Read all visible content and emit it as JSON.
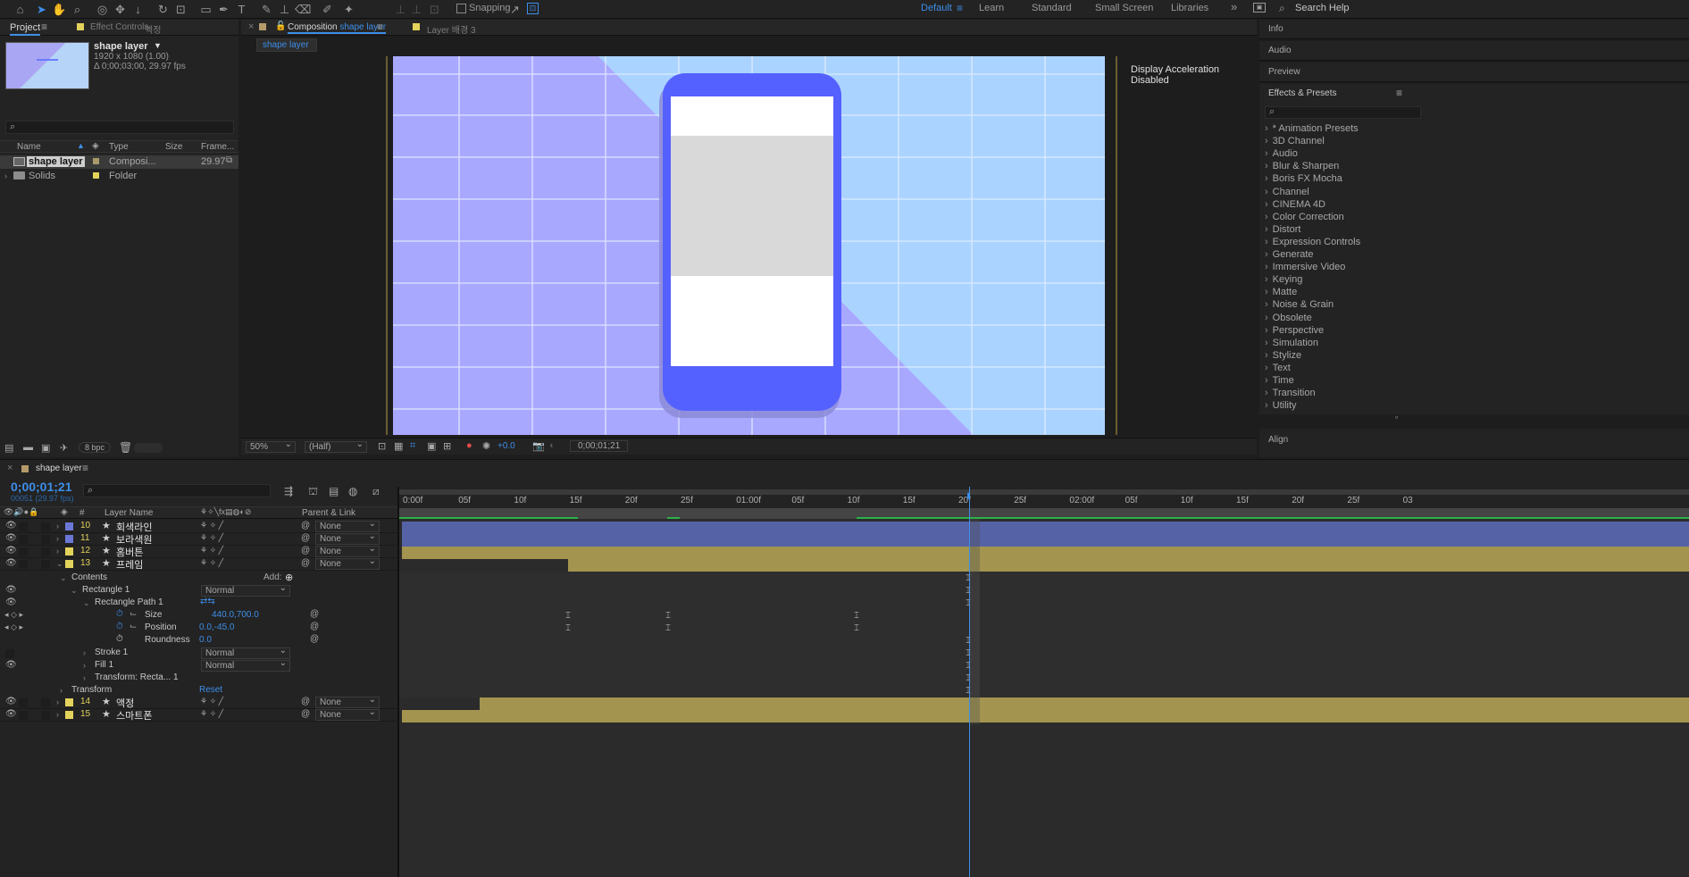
{
  "toolbar": {
    "snapping_label": "Snapping",
    "workspaces": [
      "Default",
      "Learn",
      "Standard",
      "Small Screen",
      "Libraries"
    ],
    "more": "»",
    "search_placeholder": "Search Help"
  },
  "project": {
    "tab_project": "Project",
    "tab_effect_controls": "Effect Controls",
    "tab_effect_controls_target": "액정",
    "comp_name": "shape layer",
    "comp_size": "1920 x 1080 (1.00)",
    "comp_duration": "Δ 0;00;03;00, 29.97 fps",
    "columns": [
      "Name",
      "Type",
      "Size",
      "Frame..."
    ],
    "items": [
      {
        "name": "shape layer",
        "type": "Composi...",
        "size": "",
        "fps": "29.97"
      },
      {
        "name": "Solids",
        "type": "Folder",
        "size": "",
        "fps": ""
      }
    ],
    "bpc": "8 bpc"
  },
  "composition": {
    "tab_label": "Composition",
    "tab_comp_name": "shape layer",
    "layer_tab": "Layer",
    "layer_tab_name": "배경 3",
    "breadcrumb": "shape layer",
    "accel_notice": "Display Acceleration Disabled",
    "zoom": "50%",
    "resolution": "(Half)",
    "exposure": "+0.0",
    "timecode": "0;00;01;21"
  },
  "right_panel": {
    "info": "Info",
    "audio": "Audio",
    "preview": "Preview",
    "effects_presets": "Effects & Presets",
    "effects": [
      "* Animation Presets",
      "3D Channel",
      "Audio",
      "Blur & Sharpen",
      "Boris FX Mocha",
      "Channel",
      "CINEMA 4D",
      "Color Correction",
      "Distort",
      "Expression Controls",
      "Generate",
      "Immersive Video",
      "Keying",
      "Matte",
      "Noise & Grain",
      "Obsolete",
      "Perspective",
      "Simulation",
      "Stylize",
      "Text",
      "Time",
      "Transition",
      "Utility"
    ],
    "align": "Align"
  },
  "timeline": {
    "tab_name": "shape layer",
    "timecode": "0;00;01;21",
    "frame_info": "00051 (29.97 fps)",
    "col_layer_name": "Layer Name",
    "col_num": "#",
    "col_parent": "Parent & Link",
    "ruler": [
      "0:00f",
      "05f",
      "10f",
      "15f",
      "20f",
      "25f",
      "01:00f",
      "05f",
      "10f",
      "15f",
      "20f",
      "25f",
      "02:00f",
      "05f",
      "10f",
      "15f",
      "20f",
      "25f",
      "03"
    ],
    "layers": [
      {
        "num": "10",
        "name": "회색라인",
        "parent": "None",
        "color": "#6b78d8"
      },
      {
        "num": "11",
        "name": "보라색원",
        "parent": "None",
        "color": "#6b78d8"
      },
      {
        "num": "12",
        "name": "홈버튼",
        "parent": "None",
        "color": "#e3d35b"
      },
      {
        "num": "13",
        "name": "프레임",
        "parent": "None",
        "color": "#e3d35b"
      }
    ],
    "props": {
      "contents": "Contents",
      "add": "Add:",
      "rect1": "Rectangle 1",
      "rect1_mode": "Normal",
      "rect_path": "Rectangle Path 1",
      "size": "Size",
      "size_val": "440.0,700.0",
      "position": "Position",
      "position_val": "0.0,-45.0",
      "roundness": "Roundness",
      "roundness_val": "0.0",
      "stroke": "Stroke 1",
      "stroke_mode": "Normal",
      "fill": "Fill 1",
      "fill_mode": "Normal",
      "transform_rect": "Transform: Recta... 1",
      "transform": "Transform",
      "reset": "Reset"
    },
    "layers_bottom": [
      {
        "num": "14",
        "name": "액정",
        "parent": "None",
        "color": "#e3d35b"
      },
      {
        "num": "15",
        "name": "스마트폰",
        "parent": "None",
        "color": "#e3d35b"
      }
    ]
  }
}
